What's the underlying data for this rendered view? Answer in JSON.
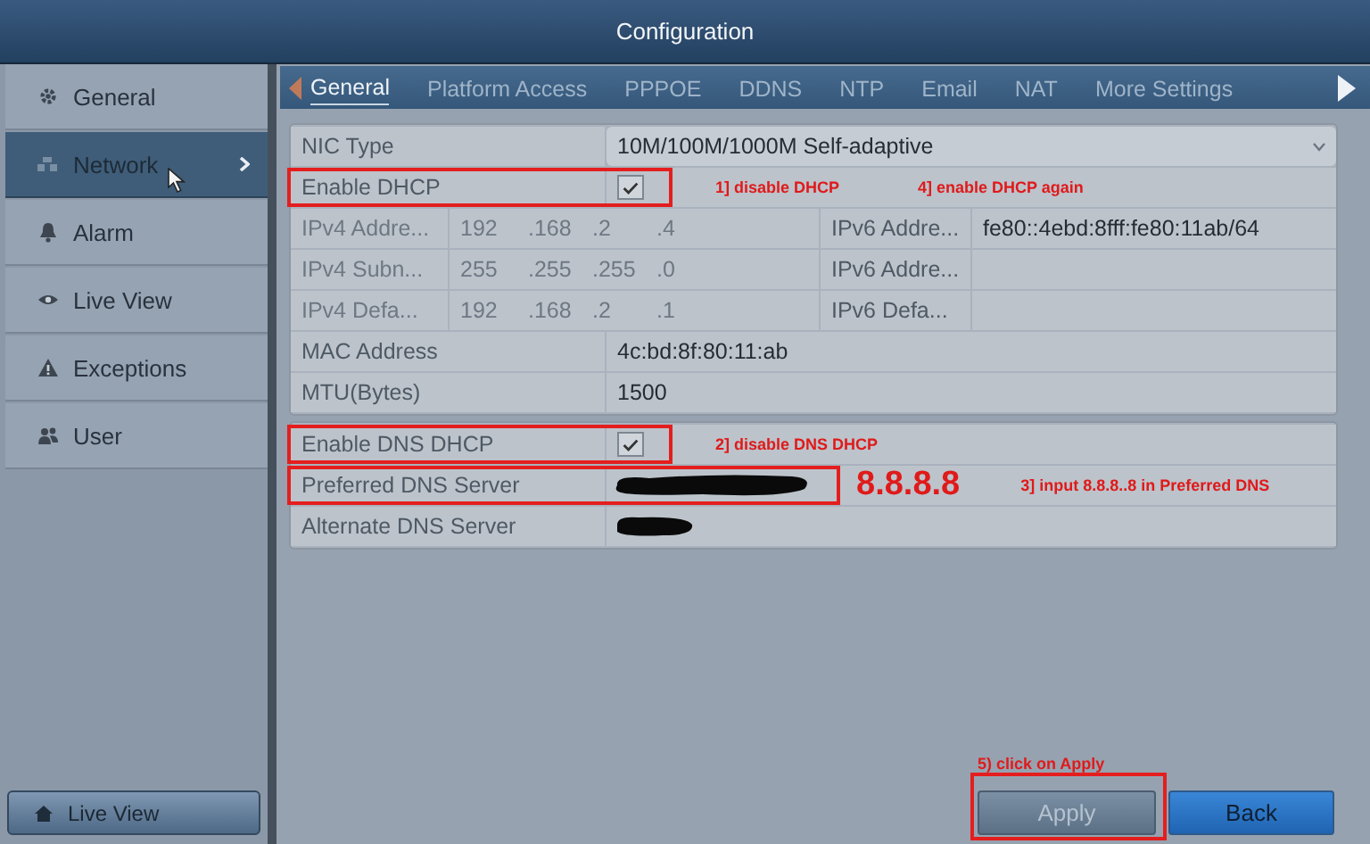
{
  "window": {
    "title": "Configuration"
  },
  "sidebar": {
    "items": [
      {
        "label": "General",
        "selected": false
      },
      {
        "label": "Network",
        "selected": true
      },
      {
        "label": "Alarm",
        "selected": false
      },
      {
        "label": "Live View",
        "selected": false
      },
      {
        "label": "Exceptions",
        "selected": false
      },
      {
        "label": "User",
        "selected": false
      }
    ],
    "footer_button": "Live View"
  },
  "tabs": [
    {
      "label": "General",
      "selected": true
    },
    {
      "label": "Platform Access",
      "selected": false
    },
    {
      "label": "PPPOE",
      "selected": false
    },
    {
      "label": "DDNS",
      "selected": false
    },
    {
      "label": "NTP",
      "selected": false
    },
    {
      "label": "Email",
      "selected": false
    },
    {
      "label": "NAT",
      "selected": false
    },
    {
      "label": "More Settings",
      "selected": false
    }
  ],
  "form": {
    "groups": [
      {
        "rows": [
          {
            "kind": "select",
            "label": "NIC Type",
            "value": "10M/100M/1000M Self-adaptive"
          },
          {
            "kind": "checkbox",
            "label": "Enable DHCP",
            "checked": true,
            "highlighted": true,
            "notes": [
              {
                "kind": "small",
                "text": "1] disable DHCP"
              },
              {
                "kind": "small",
                "text": "4] enable DHCP again"
              }
            ]
          },
          {
            "kind": "pair",
            "disabled": true,
            "label": "IPv4 Addre...",
            "segments": [
              "192",
              ".168",
              ".2",
              ".4"
            ],
            "label_2": "IPv6 Addre...",
            "value_2": "fe80::4ebd:8fff:fe80:11ab/64"
          },
          {
            "kind": "pair",
            "disabled": true,
            "label": "IPv4 Subn...",
            "segments": [
              "255",
              ".255",
              ".255",
              ".0"
            ],
            "label_2": "IPv6 Addre..."
          },
          {
            "kind": "pair",
            "disabled": true,
            "label": "IPv4 Defa...",
            "segments": [
              "192",
              ".168",
              ".2",
              ".1"
            ],
            "label_2": "IPv6 Defa..."
          },
          {
            "kind": "text",
            "label": "MAC Address",
            "value": "4c:bd:8f:80:11:ab"
          },
          {
            "kind": "text",
            "label": "MTU(Bytes)",
            "value": "1500"
          }
        ]
      },
      {
        "rows": [
          {
            "kind": "checkbox",
            "label": "Enable DNS DHCP",
            "checked": true,
            "highlighted": true,
            "notes": [
              {
                "kind": "small",
                "text": "2] disable DNS DHCP"
              }
            ]
          },
          {
            "kind": "redacted_long",
            "label": "Preferred DNS Server",
            "highlighted": true,
            "notes": [
              {
                "kind": "big",
                "text": "8.8.8.8"
              },
              {
                "kind": "small",
                "text": "3] input 8.8.8..8 in Preferred DNS"
              }
            ]
          },
          {
            "kind": "redacted_short",
            "label": "Alternate DNS Server"
          }
        ]
      }
    ]
  },
  "buttons": [
    {
      "label": "Apply",
      "disabled": true,
      "highlighted": true,
      "note": "5) click on Apply"
    },
    {
      "label": "Back",
      "disabled": false
    }
  ]
}
